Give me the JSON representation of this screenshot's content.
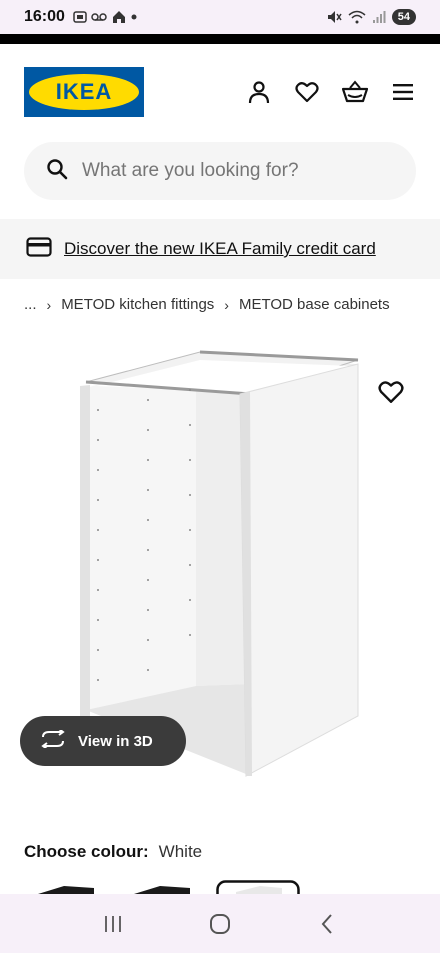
{
  "status": {
    "time": "16:00",
    "battery": "54"
  },
  "brand": {
    "logo_text": "IKEA",
    "blue": "#0058a3",
    "yellow": "#ffdb00"
  },
  "header": {
    "icons": [
      "account-icon",
      "heart-icon",
      "basket-icon",
      "menu-icon"
    ]
  },
  "search": {
    "placeholder": "What are you looking for?"
  },
  "banner": {
    "text": "Discover the new IKEA Family credit card"
  },
  "breadcrumb": {
    "ellipsis": "...",
    "items": [
      "METOD kitchen fittings",
      "METOD base cabinets"
    ]
  },
  "product": {
    "view3d_label": "View in 3D",
    "colour_label": "Choose colour:",
    "colour_value": "White"
  }
}
